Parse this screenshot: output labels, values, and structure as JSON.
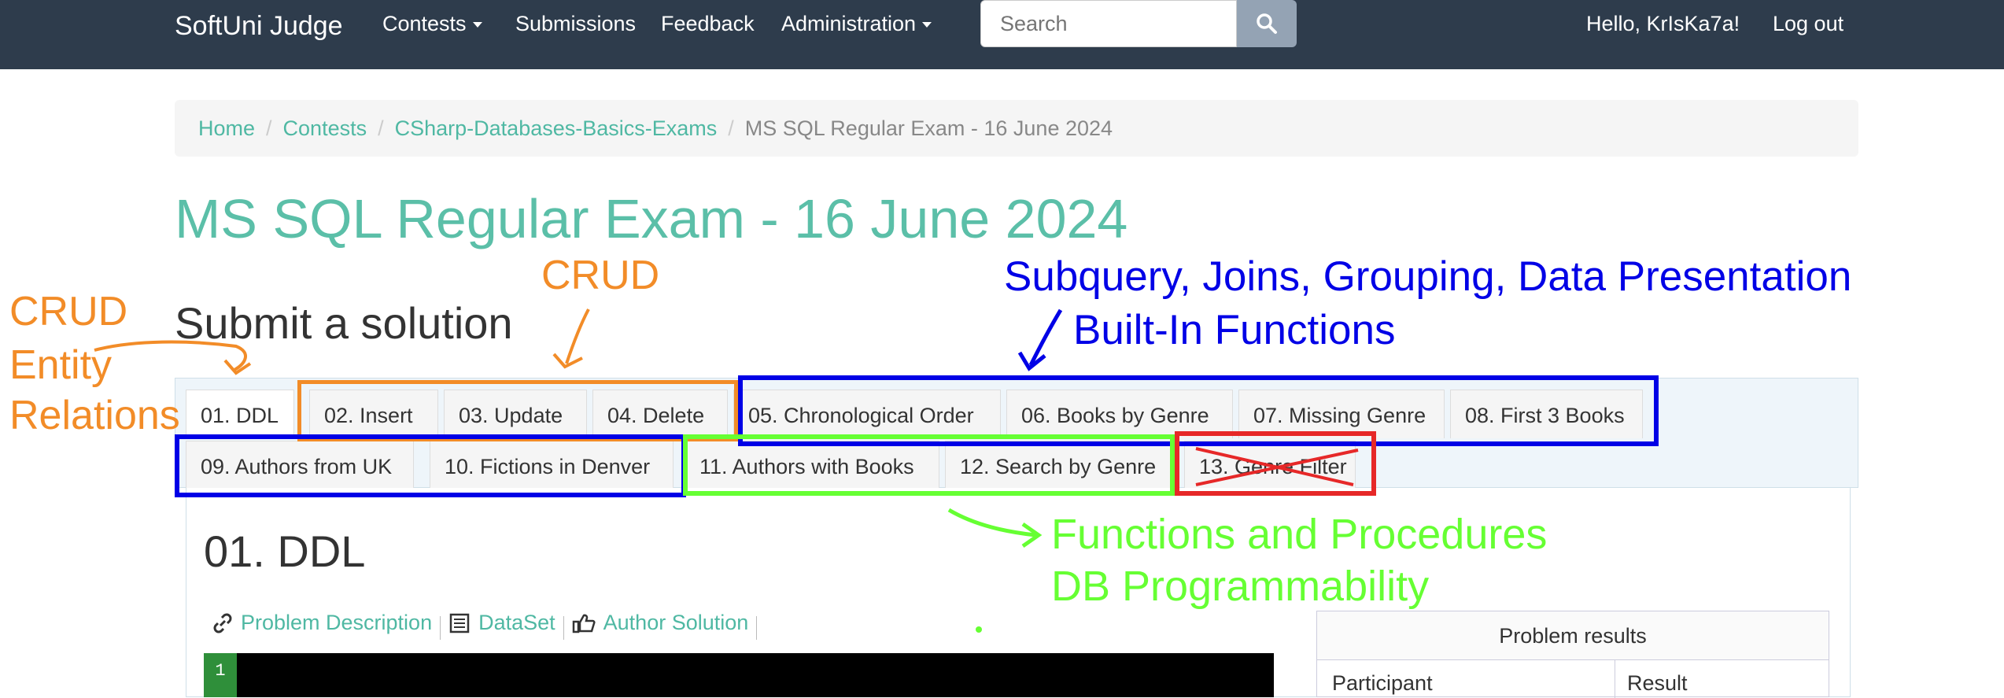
{
  "navbar": {
    "brand": "SoftUni Judge",
    "items": [
      {
        "label": "Contests",
        "dropdown": true
      },
      {
        "label": "Submissions",
        "dropdown": false
      },
      {
        "label": "Feedback",
        "dropdown": false
      },
      {
        "label": "Administration",
        "dropdown": true
      }
    ],
    "search_placeholder": "Search",
    "greeting": "Hello, KrIsKa7a!",
    "logout": "Log out"
  },
  "breadcrumb": [
    "Home",
    "Contests",
    "CSharp-Databases-Basics-Exams",
    "MS SQL Regular Exam - 16 June 2024"
  ],
  "page_title": "MS SQL Regular Exam - 16 June 2024",
  "submit_title": "Submit a solution",
  "tabs_row1": [
    "01. DDL",
    "02. Insert",
    "03. Update",
    "04. Delete",
    "05. Chronological Order",
    "06. Books by Genre",
    "07. Missing Genre",
    "08. First 3 Books"
  ],
  "tabs_row2": [
    "09. Authors from UK",
    "10. Fictions in Denver",
    "11. Authors with Books",
    "12. Search by Genre",
    "13. Genre Filter"
  ],
  "problem": {
    "title": "01. DDL",
    "links": [
      "Problem Description",
      "DataSet",
      "Author Solution"
    ],
    "editor_line": "1"
  },
  "results": {
    "header": "Problem results",
    "col_participant": "Participant",
    "col_result": "Result"
  },
  "annotations": {
    "crud_left": [
      "CRUD",
      "Entity",
      "Relations"
    ],
    "crud_top": "CRUD",
    "blue_line1": "Subquery, Joins, Grouping, Data Presentation",
    "blue_line2": "Built-In Functions",
    "green_line1": "Functions and Procedures",
    "green_line2": "DB Programmability",
    "colors": {
      "orange": "#f28c28",
      "blue": "#0000e6",
      "green": "#66ff33",
      "red": "#e62828"
    }
  }
}
